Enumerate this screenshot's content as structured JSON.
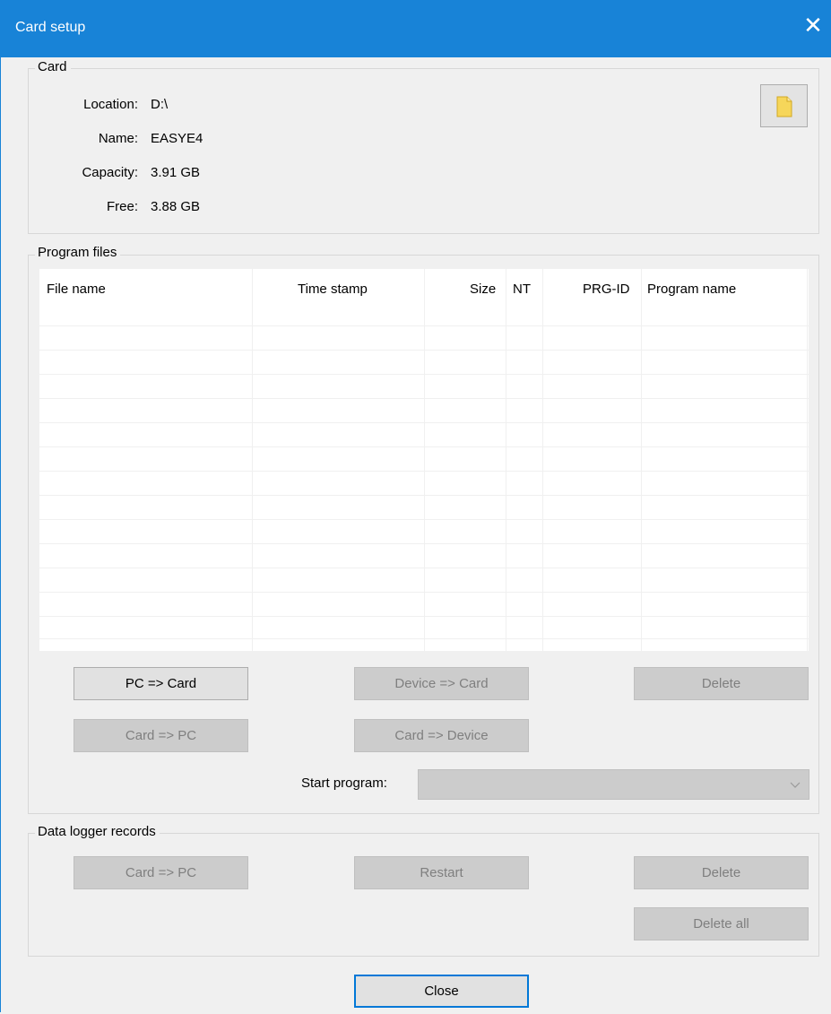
{
  "window": {
    "title": "Card setup",
    "close_glyph": "✕"
  },
  "card": {
    "group_label": "Card",
    "location_label": "Location:",
    "location_value": "D:\\",
    "name_label": "Name:",
    "name_value": "EASYE4",
    "capacity_label": "Capacity:",
    "capacity_value": "3.91 GB",
    "free_label": "Free:",
    "free_value": "3.88 GB",
    "folder_icon": "folder-icon"
  },
  "program_files": {
    "group_label": "Program files",
    "columns": [
      "File name",
      "Time stamp",
      "Size",
      "NT",
      "PRG-ID",
      "Program name"
    ],
    "rows": [],
    "buttons": {
      "pc_to_card": "PC => Card",
      "device_to_card": "Device => Card",
      "delete": "Delete",
      "card_to_pc": "Card => PC",
      "card_to_device": "Card => Device"
    },
    "start_program_label": "Start program:",
    "start_program_value": ""
  },
  "data_logger": {
    "group_label": "Data logger records",
    "buttons": {
      "card_to_pc": "Card => PC",
      "restart": "Restart",
      "delete": "Delete",
      "delete_all": "Delete all"
    }
  },
  "footer": {
    "close_label": "Close"
  },
  "colors": {
    "title_bar": "#1883d7",
    "background": "#f0f0f0",
    "disabled_button": "#cccccc",
    "default_border": "#0078d7"
  }
}
